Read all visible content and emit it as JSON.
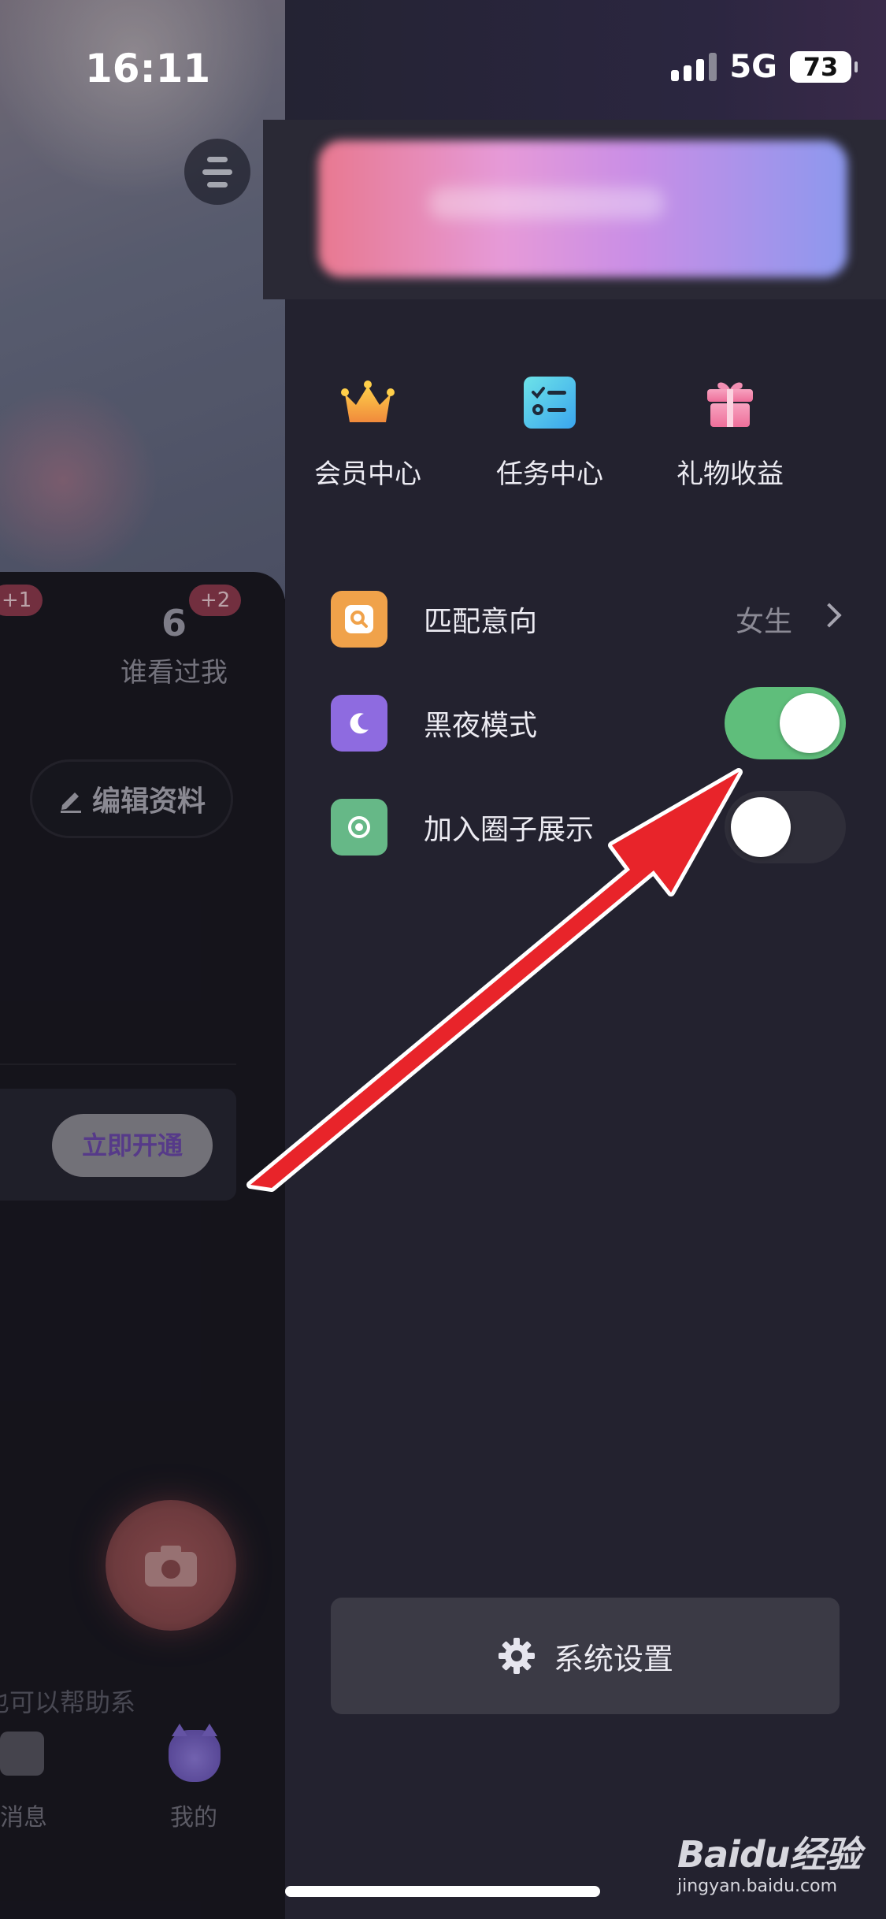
{
  "status_bar": {
    "time": "16:11",
    "network": "5G",
    "battery": "73"
  },
  "background_page": {
    "stats": [
      {
        "value": "",
        "label": "",
        "badge": "+1"
      },
      {
        "value": "6",
        "label": "谁看过我",
        "badge": "+2"
      }
    ],
    "edit_profile_label": "编辑资料",
    "vip_button_label": "立即开通",
    "hint_text": "也可以帮助系",
    "tabs": [
      {
        "label": "消息"
      },
      {
        "label": "我的"
      }
    ]
  },
  "drawer": {
    "quick_actions": [
      {
        "label": "会员中心",
        "icon": "crown-icon"
      },
      {
        "label": "任务中心",
        "icon": "task-list-icon"
      },
      {
        "label": "礼物收益",
        "icon": "gift-icon"
      }
    ],
    "rows": [
      {
        "label": "匹配意向",
        "value": "女生",
        "icon": "search-icon",
        "icon_color": "#f0a24a"
      },
      {
        "label": "黑夜模式",
        "icon": "moon-icon",
        "icon_color": "#8e6be0",
        "toggle_on": true
      },
      {
        "label": "加入圈子展示",
        "icon": "circle-target-icon",
        "icon_color": "#66b887",
        "toggle_on": false
      }
    ],
    "settings_label": "系统设置"
  },
  "watermark": {
    "brand": "Baidu经验",
    "url": "jingyan.baidu.com"
  },
  "colors": {
    "toggle_on": "#5fbe7b",
    "toggle_off": "#2f2e39",
    "annotation_arrow": "#e8242a"
  }
}
